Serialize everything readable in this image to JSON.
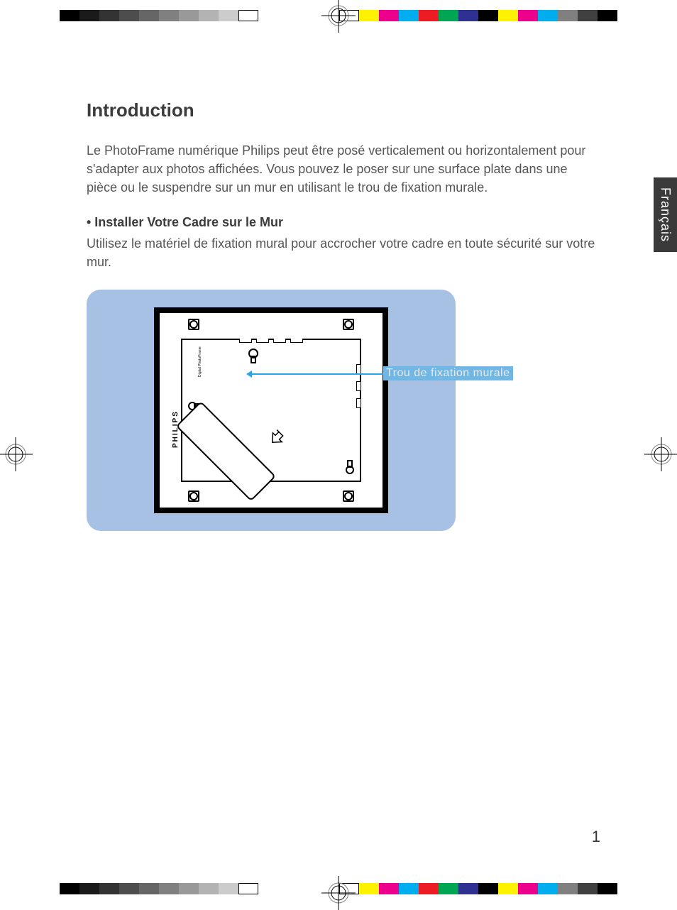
{
  "language_tab": "Français",
  "title": "Introduction",
  "intro_paragraph": "Le PhotoFrame numérique Philips peut être posé verticalement ou horizontalement pour s'adapter aux photos affichées. Vous pouvez le poser sur une surface plate dans une pièce ou le suspendre sur un mur en utilisant le trou de fixation murale.",
  "section_bullet": "• Installer Votre Cadre sur le Mur",
  "section_body": "Utilisez le matériel de fixation mural pour accrocher votre cadre en toute sécurité sur votre mur.",
  "diagram": {
    "callout_label": "Trou de fixation murale",
    "brand_text": "PHILIPS",
    "tiny_label": "Digital PhotoFrame"
  },
  "page_number": "1",
  "print_marks": {
    "gray_shades": [
      "#000000",
      "#1a1a1a",
      "#333333",
      "#4d4d4d",
      "#666666",
      "#808080",
      "#999999",
      "#b3b3b3",
      "#cccccc",
      "#ffffff"
    ],
    "color_swatches": [
      "#ffffff",
      "#fff200",
      "#ec008c",
      "#00aeef",
      "#ed1c24",
      "#00a651",
      "#2e3192",
      "#000000",
      "#fff200",
      "#ec008c",
      "#00aeef",
      "#808080",
      "#404040",
      "#000000"
    ]
  }
}
